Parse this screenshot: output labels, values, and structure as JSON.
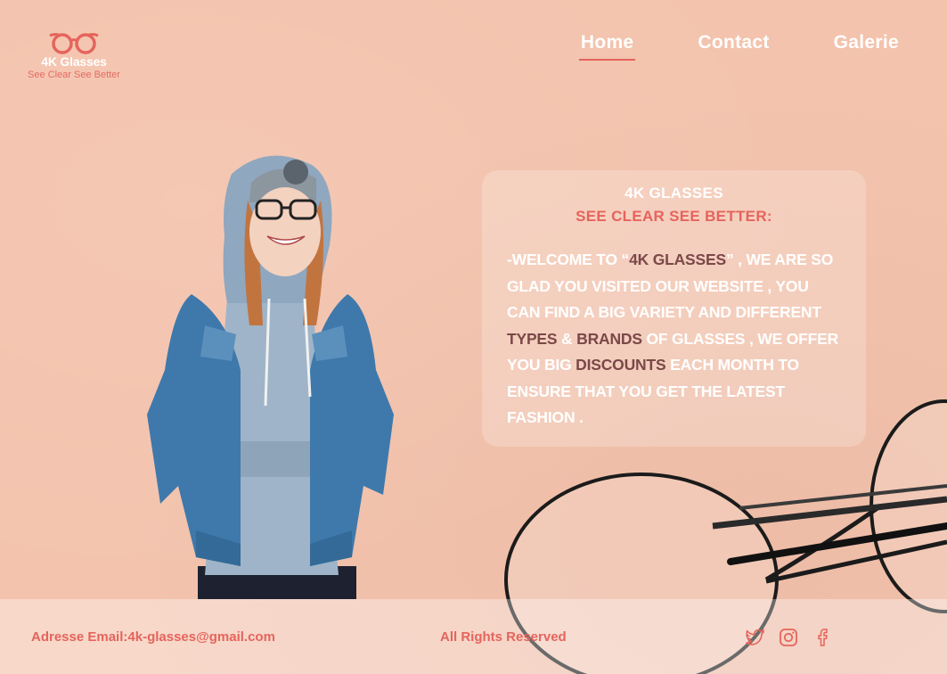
{
  "brand": {
    "name": "4K Glasses",
    "tagline": "See Clear See Better",
    "accent_color": "#e5645c",
    "icon": "glasses-icon"
  },
  "nav": {
    "items": [
      {
        "label": "Home",
        "active": true
      },
      {
        "label": "Contact",
        "active": false
      },
      {
        "label": "Galerie",
        "active": false
      }
    ]
  },
  "hero": {
    "image": "person-denim-jacket-glasses",
    "decor_image": "round-eyeglasses"
  },
  "card": {
    "title": "4K Glasses",
    "slogan": "See Clear See Better:",
    "body": {
      "p1": "-Welcome to “",
      "brand_highlight": "4K Glasses",
      "p2": "” , we are so glad you visited our website , you can find a big variety and different ",
      "types": "Types",
      "amp": " & ",
      "brands": "Brands",
      "p3": " of glasses , we offer you big ",
      "discounts": "Discounts",
      "p4": " each month to ensure that you get the latest fashion ."
    }
  },
  "footer": {
    "email": "Adresse Email:4k-glasses@gmail.com",
    "rights": "All Rights Reserved",
    "social_icons": [
      "twitter-icon",
      "instagram-icon",
      "facebook-icon"
    ]
  }
}
